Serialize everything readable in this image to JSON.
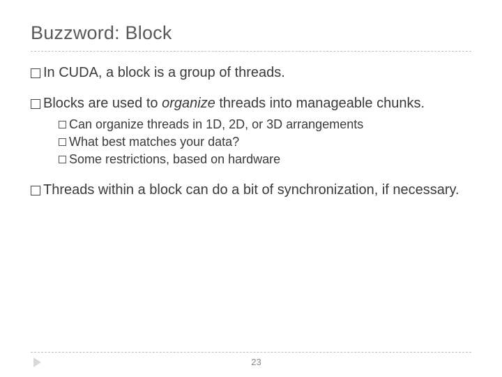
{
  "title": "Buzzword: Block",
  "bullets": {
    "b1": "In CUDA, a block is a group of threads.",
    "b2_pre": "Blocks are used to ",
    "b2_em": "organize",
    "b2_post": " threads into manageable chunks.",
    "b2_sub": {
      "s1": "Can organize threads in 1D, 2D, or 3D arrangements",
      "s2": "What best matches your data?",
      "s3": "Some restrictions, based on hardware"
    },
    "b3": "Threads within a block can do a bit of synchronization, if necessary."
  },
  "page_number": "23"
}
